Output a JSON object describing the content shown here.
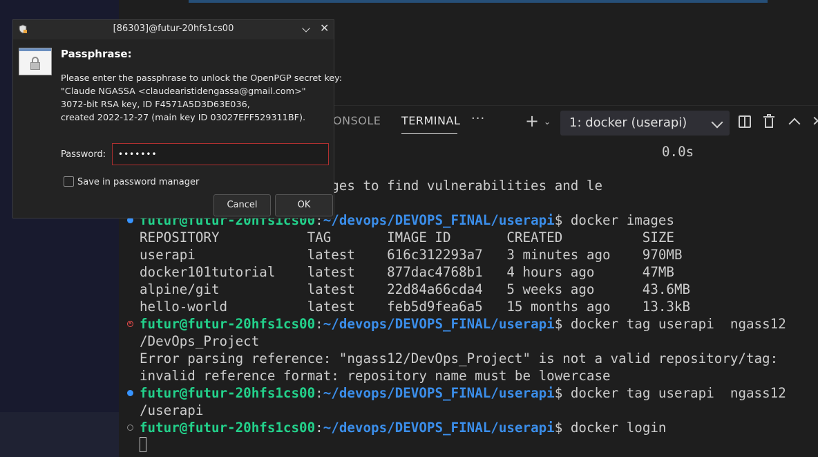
{
  "panel": {
    "tabs": [
      {
        "label": "ONSOLE"
      },
      {
        "label": "TERMINAL"
      }
    ],
    "more_label": "···",
    "add_label": "+",
    "terminal_select": "1: docker (userapi)"
  },
  "terminal": {
    "timing": "0.0s",
    "partial_line": "n Snyk tests against images to find vulnerabilities and le",
    "prompt_user": "futur@futur-20hfs1cs00",
    "prompt_path": "~/devops/DEVOPS_FINAL/userapi",
    "prompt_sep": ":",
    "prompt_dollar": "$",
    "commands": [
      " docker images",
      " docker tag userapi  ngass12",
      " docker tag userapi  ngass12",
      " docker login"
    ],
    "images_header": "REPOSITORY           TAG       IMAGE ID       CREATED          SIZE",
    "images_rows": [
      "userapi              latest    616c312293a7   3 minutes ago    970MB",
      "docker101tutorial    latest    877dac4768b1   4 hours ago      47MB",
      "alpine/git           latest    22d84a66cda4   5 weeks ago      43.6MB",
      "hello-world          latest    feb5d9fea6a5   15 months ago    13.3kB"
    ],
    "wrap_1": "/DevOps_Project",
    "error_1": "Error parsing reference: \"ngass12/DevOps_Project\" is not a valid repository/tag:",
    "error_2": "invalid reference format: repository name must be lowercase",
    "wrap_2": "/userapi"
  },
  "dialog": {
    "title": "[86303]@futur-20hfs1cs00",
    "heading": "Passphrase:",
    "message": [
      "Please enter the passphrase to unlock the OpenPGP secret key:",
      "\"Claude NGASSA <claudearistidengassa@gmail.com>\"",
      "3072-bit RSA key, ID F4571A5D3D63E036,",
      "created 2022-12-27 (main key ID 03027EFF529311BF)."
    ],
    "password_label": "Password:",
    "password_value": "•••••••",
    "save_label": "Save in password manager",
    "cancel_label": "Cancel",
    "ok_label": "OK"
  }
}
